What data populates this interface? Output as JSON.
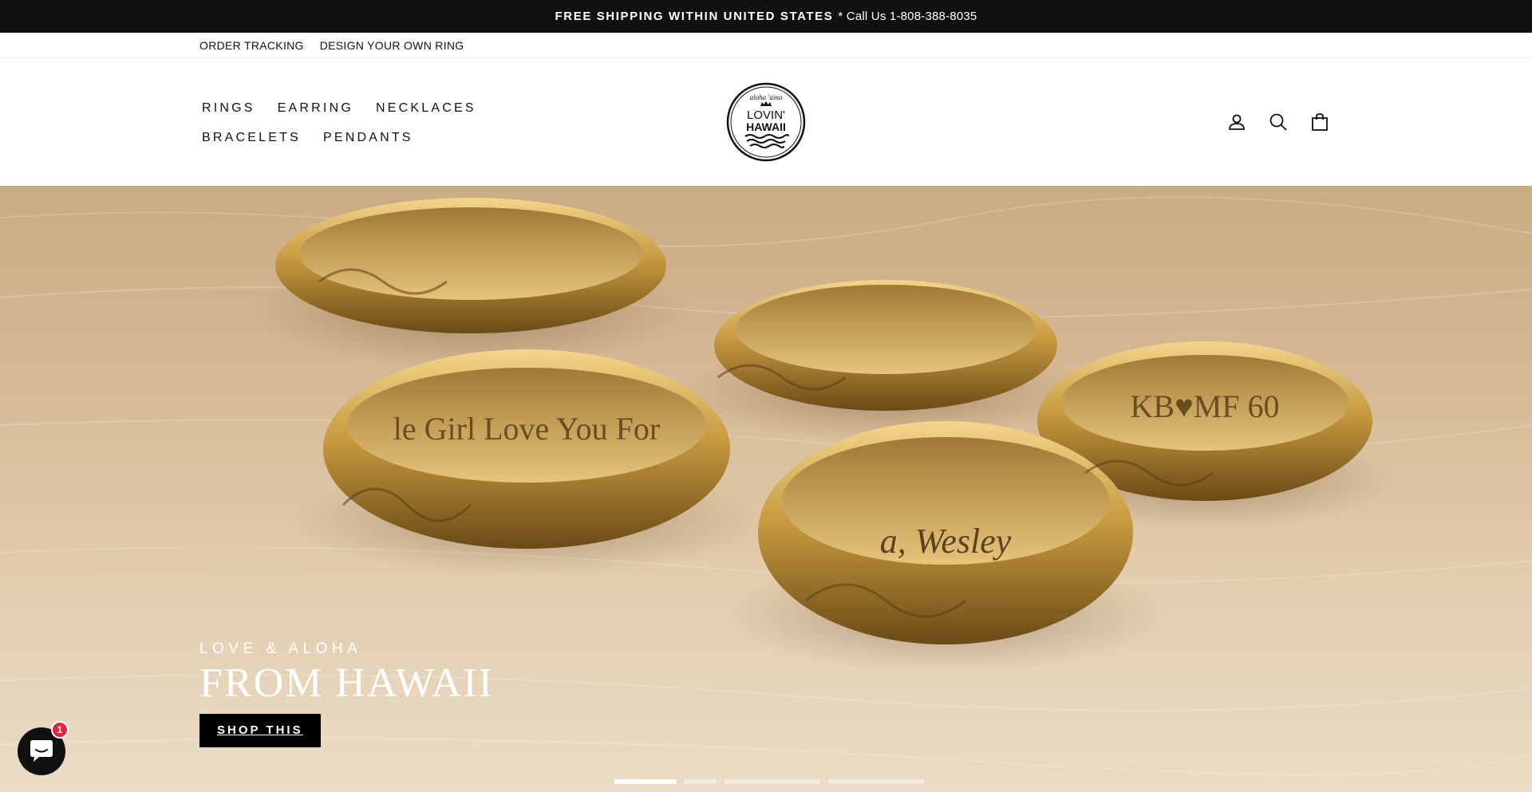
{
  "announcement": {
    "bold_text": "FREE SHIPPING WITHIN UNITED STATES",
    "rest_text": "* Call Us 1-808-388-8035"
  },
  "utility_links": [
    "ORDER TRACKING",
    "DESIGN YOUR OWN RING"
  ],
  "nav": [
    "RINGS",
    "EARRING",
    "NECKLACES",
    "BRACELETS",
    "PENDANTS"
  ],
  "logo": {
    "top_text": "aloha 'aina",
    "line1": "LOVIN'",
    "line2": "HAWAII"
  },
  "header_icons": [
    "account-icon",
    "search-icon",
    "cart-bag-icon"
  ],
  "hero": {
    "eyebrow": "LOVE & ALOHA",
    "headline": "FROM HAWAII",
    "button": "SHOP THIS",
    "engravings": [
      "le Girl Love You For",
      "KB♥MF 60",
      "a, Wesley"
    ],
    "slide_count": 4,
    "active_slide": 1
  },
  "chat": {
    "badge_count": "1"
  },
  "colors": {
    "announcement_bg": "#111111",
    "button_bg": "#000000",
    "badge": "#e2243a",
    "gold": "#c9a14a"
  }
}
